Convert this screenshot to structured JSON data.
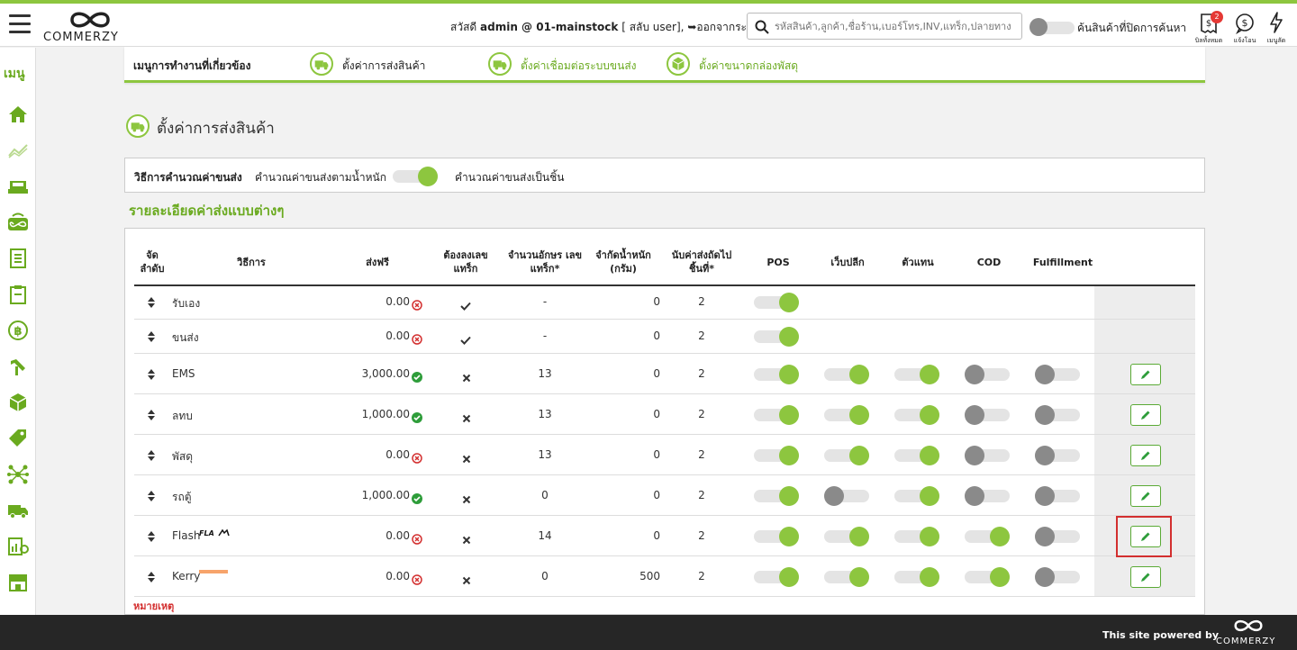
{
  "header": {
    "logo_text": "COMMERZY",
    "greeting_prefix": "สวัสดี",
    "user": "admin @ 01-mainstock",
    "switch_user": "[ สลับ user],",
    "logout": "ออกจากระบบ",
    "search_placeholder": "รหัสสินค้า,ลูกค้า,ชื่อร้าน,เบอร์โทร,INV,แทร็ก,ปลายทาง",
    "hidden_search_label": "ค้นสินค้าที่ปิดการค้นหา",
    "icons": [
      {
        "name": "invoice-icon",
        "label": "บิลทั้งหมด",
        "badge": "2"
      },
      {
        "name": "payment-icon",
        "label": "แจ้งโอน"
      },
      {
        "name": "lightning-icon",
        "label": "เมนูลัด"
      }
    ]
  },
  "sidebar": {
    "menu_label": "เมนู",
    "icons": [
      "home-icon",
      "chart-icon",
      "cashier-icon",
      "online-icon",
      "document-icon",
      "clipboard-icon",
      "baht-icon",
      "tools-icon",
      "box-icon",
      "tag-icon",
      "network-icon",
      "truck-icon",
      "report-icon",
      "store-icon"
    ]
  },
  "quick_menu": {
    "title": "เมนูการทำงานที่เกี่ยวข้อง",
    "items": [
      {
        "label": "ตั้งค่าการส่งสินค้า"
      },
      {
        "label": "ตั้งค่าเชื่อมต่อระบบขนส่ง"
      },
      {
        "label": "ตั้งค่าขนาดกล่องพัสดุ"
      }
    ]
  },
  "page": {
    "title": "ตั้งค่าการส่งสินค้า",
    "calc_label": "วิธีการคำนวณค่าขนส่ง",
    "calc_option_weight": "คำนวณค่าขนส่งตามน้ำหนัก",
    "calc_option_piece": "คำนวณค่าขนส่งเป็นชิ้น",
    "calc_mode_piece": true,
    "section_title": "รายละเอียดค่าส่งแบบต่างๆ",
    "note": "หมายเหตุ"
  },
  "table": {
    "headers": {
      "order": "จัด ลำดับ",
      "method": "วิธีการ",
      "free": "ส่งฟรี",
      "track_required": "ต้องลงเลข แทร็ก",
      "track_chars": "จำนวนอักษร เลขแทร็ก*",
      "weight_limit": "จำกัดน้ำหนัก (กรัม)",
      "count_from": "นับค่าส่งถัดไป ชิ้นที่*",
      "pos": "POS",
      "web": "เว็บปลีก",
      "agent": "ตัวแทน",
      "cod": "COD",
      "fulfillment": "Fulfillment"
    },
    "rows": [
      {
        "method": "รับเอง",
        "free": "0.00",
        "free_status": "no",
        "track": "check",
        "chars": "-",
        "weight": "0",
        "count": "2",
        "pos": true,
        "web": null,
        "agent": null,
        "cod": null,
        "ful": null,
        "editable": false
      },
      {
        "method": "ขนส่ง",
        "free": "0.00",
        "free_status": "no",
        "track": "check",
        "chars": "-",
        "weight": "0",
        "count": "2",
        "pos": true,
        "web": null,
        "agent": null,
        "cod": null,
        "ful": null,
        "editable": false
      },
      {
        "method": "EMS",
        "free": "3,000.00",
        "free_status": "yes",
        "track": "cross",
        "chars": "13",
        "weight": "0",
        "count": "2",
        "pos": true,
        "web": true,
        "agent": true,
        "cod": false,
        "ful": false,
        "editable": true
      },
      {
        "method": "ลทบ",
        "free": "1,000.00",
        "free_status": "yes",
        "track": "cross",
        "chars": "13",
        "weight": "0",
        "count": "2",
        "pos": true,
        "web": true,
        "agent": true,
        "cod": false,
        "ful": false,
        "editable": true
      },
      {
        "method": "พัสดุ",
        "free": "0.00",
        "free_status": "no",
        "track": "cross",
        "chars": "13",
        "weight": "0",
        "count": "2",
        "pos": true,
        "web": true,
        "agent": true,
        "cod": false,
        "ful": false,
        "editable": true
      },
      {
        "method": "รถตู้",
        "free": "1,000.00",
        "free_status": "yes",
        "track": "cross",
        "chars": "0",
        "weight": "0",
        "count": "2",
        "pos": true,
        "web": false,
        "agent": true,
        "cod": false,
        "ful": false,
        "editable": true
      },
      {
        "method": "Flash",
        "logo": "flash",
        "free": "0.00",
        "free_status": "no",
        "track": "cross",
        "chars": "14",
        "weight": "0",
        "count": "2",
        "pos": true,
        "web": true,
        "agent": true,
        "cod": true,
        "ful": false,
        "editable": true,
        "highlighted": true
      },
      {
        "method": "Kerry",
        "logo": "kerry",
        "free": "0.00",
        "free_status": "no",
        "track": "cross",
        "chars": "0",
        "weight": "500",
        "count": "2",
        "pos": true,
        "web": true,
        "agent": true,
        "cod": true,
        "ful": false,
        "editable": true
      }
    ]
  },
  "footer": {
    "powered_by": "This site powered by",
    "logo_text": "COMMERZY"
  },
  "colors": {
    "accent": "#8dc63f",
    "accent_dark": "#6aaa1f",
    "toggle_off": "#8a8a8a",
    "danger": "#d32f2f",
    "footer_bg": "#262626"
  }
}
